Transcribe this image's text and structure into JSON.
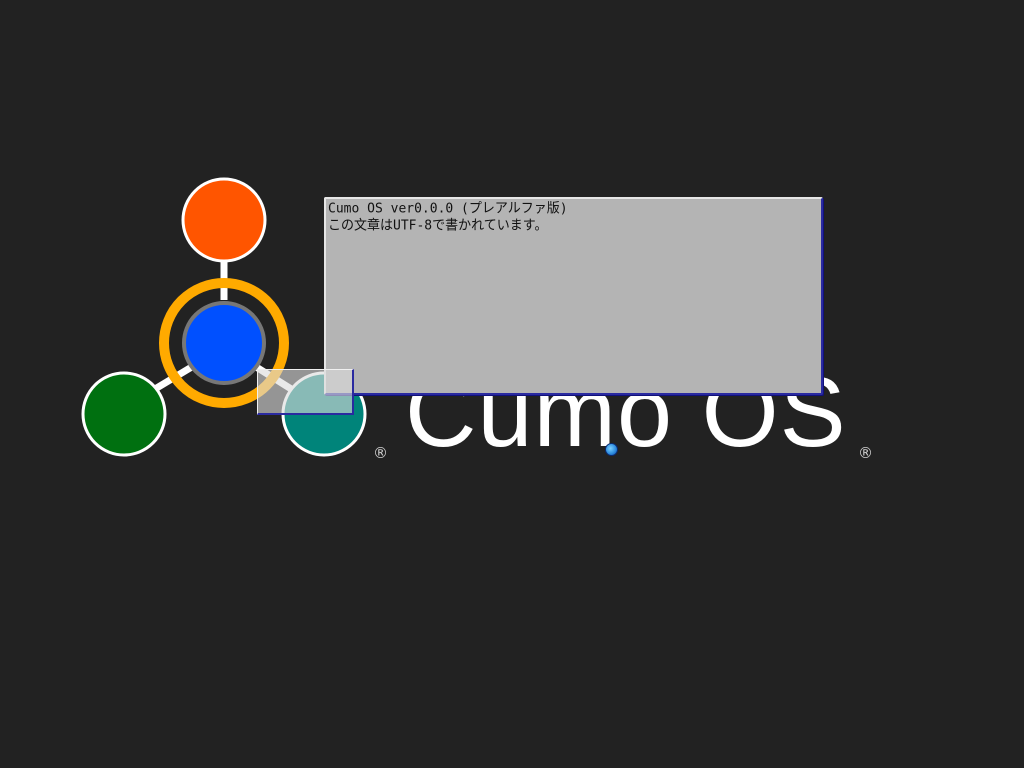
{
  "logo": {
    "wordmark": "Cumo OS",
    "registered_mark_1": "®",
    "registered_mark_2": "®",
    "colors": {
      "top_node": "#ff5500",
      "center_node": "#0050ff",
      "center_ring": "#ffaa00",
      "left_node": "#007010",
      "right_node": "#00847a",
      "node_outline": "#ffffff",
      "wordmark": "#ffffff"
    }
  },
  "console": {
    "line1": "Cumo OS ver0.0.0 (プレアルファ版)",
    "line2": "この文章はUTF-8で書かれています。"
  },
  "desktop": {
    "background": "#222222"
  },
  "cursor": {
    "icon": "circle-pointer-icon"
  }
}
